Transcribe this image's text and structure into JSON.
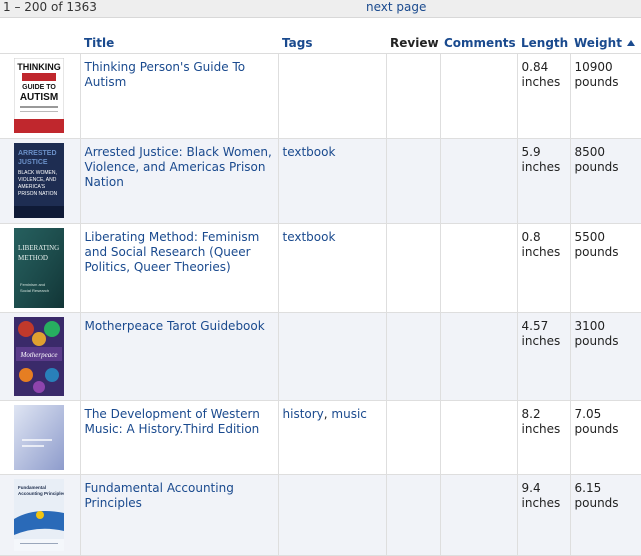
{
  "pager": {
    "range": "1 – 200 of 1363",
    "next": "next page"
  },
  "columns": {
    "title": "Title",
    "tags": "Tags",
    "review": "Review",
    "comments": "Comments",
    "length": "Length",
    "weight": "Weight"
  },
  "rows": [
    {
      "title": "Thinking Person's Guide To Autism",
      "tags": [],
      "length": "0.84 inches",
      "weight": "10900 pounds",
      "cover": {
        "bg": "#ffffff",
        "accent": "#c0272d",
        "text": "THINKING PERSON'S GUIDE TO AUTISM"
      }
    },
    {
      "title": "Arrested Justice: Black Women, Violence, and Americas Prison Nation",
      "tags": [
        "textbook"
      ],
      "length": "5.9 inches",
      "weight": "8500 pounds",
      "cover": {
        "bg": "#1e2d52",
        "accent": "#6a8fc7",
        "text": "ARRESTED JUSTICE"
      }
    },
    {
      "title": "Liberating Method: Feminism and Social Research (Queer Politics, Queer Theories)",
      "tags": [
        "textbook"
      ],
      "length": "0.8 inches",
      "weight": "5500 pounds",
      "cover": {
        "bg": "#1b4a4c",
        "accent": "#7fb0a8",
        "text": "LIBERATING METHOD"
      }
    },
    {
      "title": "Motherpeace Tarot Guidebook",
      "tags": [],
      "length": "4.57 inches",
      "weight": "3100 pounds",
      "cover": {
        "bg": "#3a2a6a",
        "accent": "#e0a030",
        "text": "Motherpeace"
      }
    },
    {
      "title": "The Development of Western Music: A History.Third Edition",
      "tags": [
        "history",
        "music"
      ],
      "length": "8.2 inches",
      "weight": "7.05 pounds",
      "cover": {
        "bg": "#b8c4e2",
        "accent": "#8e9ccc",
        "text": ""
      }
    },
    {
      "title": "Fundamental Accounting Principles",
      "tags": [],
      "length": "9.4 inches",
      "weight": "6.15 pounds",
      "cover": {
        "bg": "#e8eef6",
        "accent": "#2a6ab8",
        "text": "Fundamental Accounting Principles"
      }
    }
  ]
}
